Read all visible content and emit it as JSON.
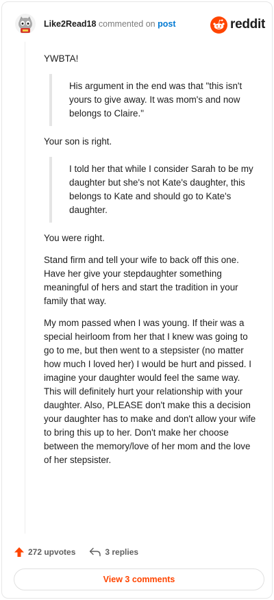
{
  "header": {
    "username": "Like2Read18",
    "action_text": "commented on",
    "post_link": "post",
    "brand": "reddit",
    "brand_color": "#ff4500"
  },
  "comment": {
    "paragraphs": [
      {
        "type": "text",
        "text": "YWBTA!"
      },
      {
        "type": "quote",
        "text": "His argument in the end was that \"this isn't yours to give away. It was mom's and now belongs to Claire.\""
      },
      {
        "type": "text",
        "text": "Your son is right."
      },
      {
        "type": "quote",
        "text": "I told her that while I consider Sarah to be my daughter but she's not Kate's daughter, this belongs to Kate and should go to Kate's daughter."
      },
      {
        "type": "text",
        "text": "You were right."
      },
      {
        "type": "text",
        "text": "Stand firm and tell your wife to back off this one. Have her give your stepdaughter something meaningful of hers and start the tradition in your family that way."
      },
      {
        "type": "text",
        "text": "My mom passed when I was young. If their was a special heirloom from her that I knew was going to go to me, but then went to a stepsister (no matter how much I loved her) I would be hurt and pissed. I imagine your daughter would feel the same way. This will definitely hurt your relationship with your daughter. Also, PLEASE don't make this a decision your daughter has to make and don't allow your wife to bring this up to her. Don't make her choose between the memory/love of her mom and the love of her stepsister."
      }
    ]
  },
  "actions": {
    "upvotes": "272 upvotes",
    "replies": "3 replies",
    "view_comments": "View 3 comments",
    "upvote_color": "#ff4500"
  }
}
